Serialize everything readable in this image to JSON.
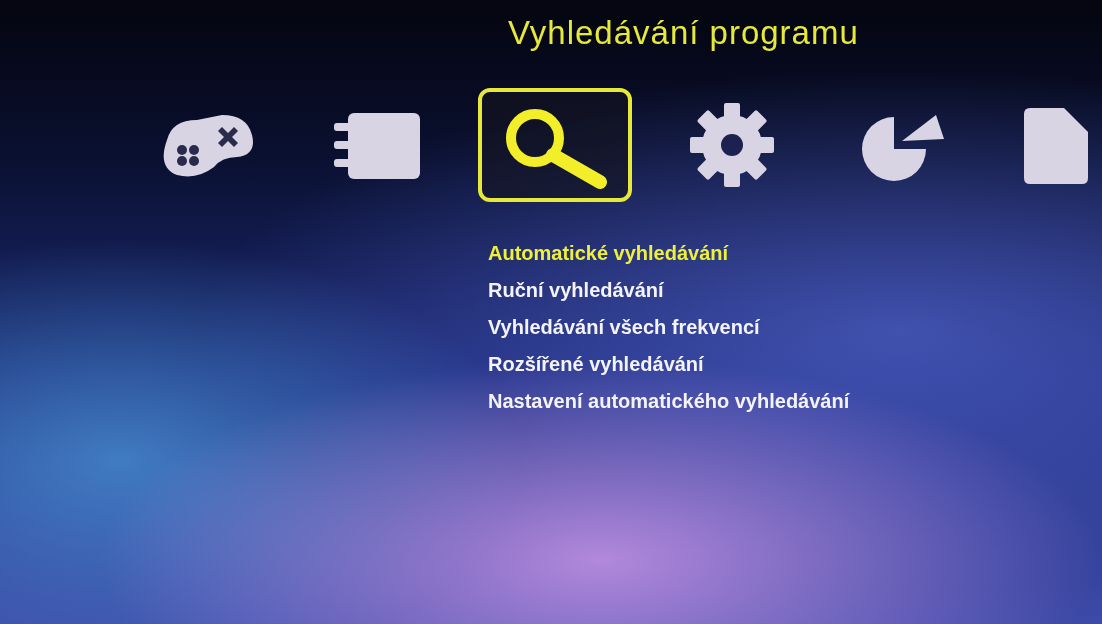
{
  "title": "Vyhledávání programu",
  "categories": [
    {
      "kind": "gamepad",
      "selected": false
    },
    {
      "kind": "notebook",
      "selected": false
    },
    {
      "kind": "search",
      "selected": true
    },
    {
      "kind": "gear",
      "selected": false
    },
    {
      "kind": "pie",
      "selected": false
    },
    {
      "kind": "document",
      "selected": false
    }
  ],
  "menu": [
    {
      "label": "Automatické vyhledávání",
      "selected": true
    },
    {
      "label": "Ruční vyhledávání",
      "selected": false
    },
    {
      "label": "Vyhledávání všech frekvencí",
      "selected": false
    },
    {
      "label": "Rozšířené vyhledávání",
      "selected": false
    },
    {
      "label": "Nastavení automatického vyhledávání",
      "selected": false
    }
  ]
}
